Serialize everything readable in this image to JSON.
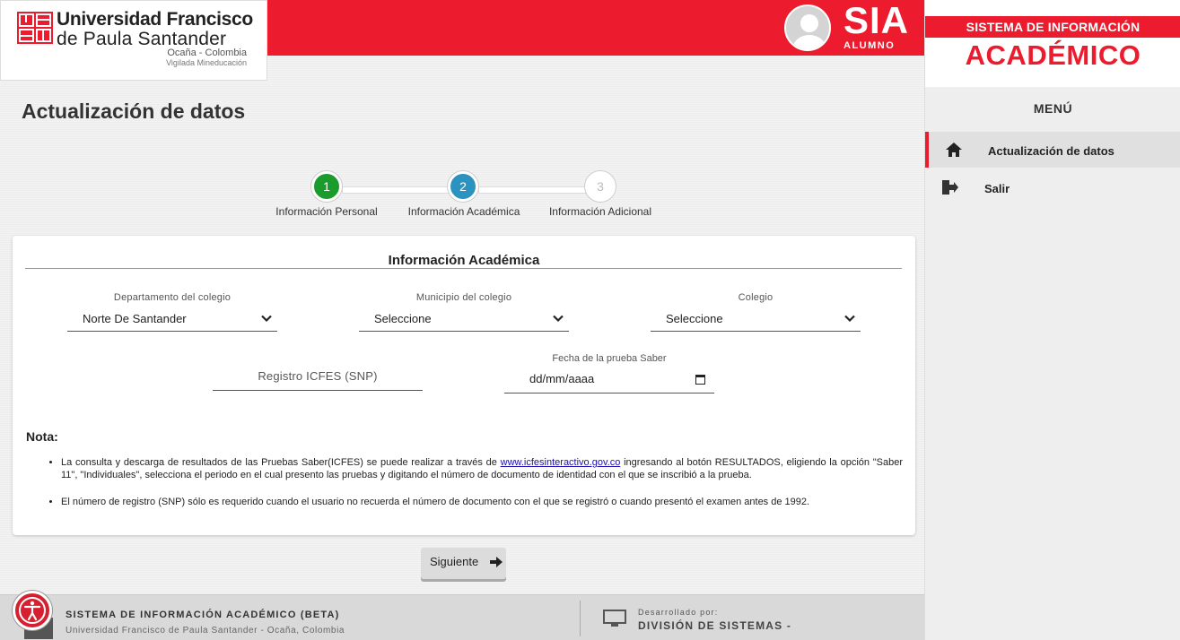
{
  "header": {
    "university_line1": "Universidad Francisco",
    "university_line2": "de Paula Santander",
    "city": "Ocaña - Colombia",
    "vigilada": "Vigilada Mineducación",
    "app_name": "SIA",
    "app_role": "ALUMNO",
    "brand_color": "#ec1c2e"
  },
  "page": {
    "title": "Actualización de datos"
  },
  "stepper": {
    "steps": [
      {
        "number": "1",
        "label": "Información Personal",
        "status": "completed",
        "color": "#1a9b2b"
      },
      {
        "number": "2",
        "label": "Información Académica",
        "status": "active",
        "color": "#2c93c0"
      },
      {
        "number": "3",
        "label": "Información Adicional",
        "status": "pending",
        "color": "#ffffff"
      }
    ]
  },
  "form": {
    "section_title": "Información Académica",
    "departamento_label": "Departamento del colegio",
    "departamento_value": "Norte De Santander",
    "municipio_label": "Municipio del colegio",
    "municipio_value": "Seleccione",
    "colegio_label": "Colegio",
    "colegio_value": "Seleccione",
    "snp_placeholder": "Registro ICFES (SNP)",
    "fecha_label": "Fecha de la prueba Saber",
    "fecha_value": "dd/mm/aaaa"
  },
  "note": {
    "title": "Nota:",
    "item1_before_link": "La consulta y descarga de resultados de las Pruebas Saber(ICFES) se puede realizar a través de ",
    "item1_link": "www.icfesinteractivo.gov.co",
    "item1_after_link": " ingresando al botón RESULTADOS, eligiendo la opción \"Saber 11\", \"Individuales\", selecciona el periodo en el cual presento las pruebas y digitando el número de documento de identidad con el que se inscribió a la prueba.",
    "item2": "El número de registro (SNP) sólo es requerido cuando el usuario no recuerda el número de documento con el que se registró o cuando presentó el examen antes de 1992."
  },
  "actions": {
    "next_label": "Siguiente"
  },
  "footer": {
    "title": "SISTEMA DE INFORMACIÓN ACADÉMICO (BETA)",
    "subtitle": "Universidad Francisco de Paula Santander - Ocaña, Colombia",
    "dev_label": "Desarrollado por:",
    "dev_name": "DIVISIÓN DE SISTEMAS -"
  },
  "sidebar": {
    "heading_top": "SISTEMA DE INFORMACIÓN",
    "heading_main": "ACADÉMICO",
    "menu_title": "MENÚ",
    "items": [
      {
        "label": "Actualización de datos",
        "icon": "home-icon",
        "active": true
      },
      {
        "label": "Salir",
        "icon": "sign-out-icon",
        "active": false
      }
    ]
  }
}
